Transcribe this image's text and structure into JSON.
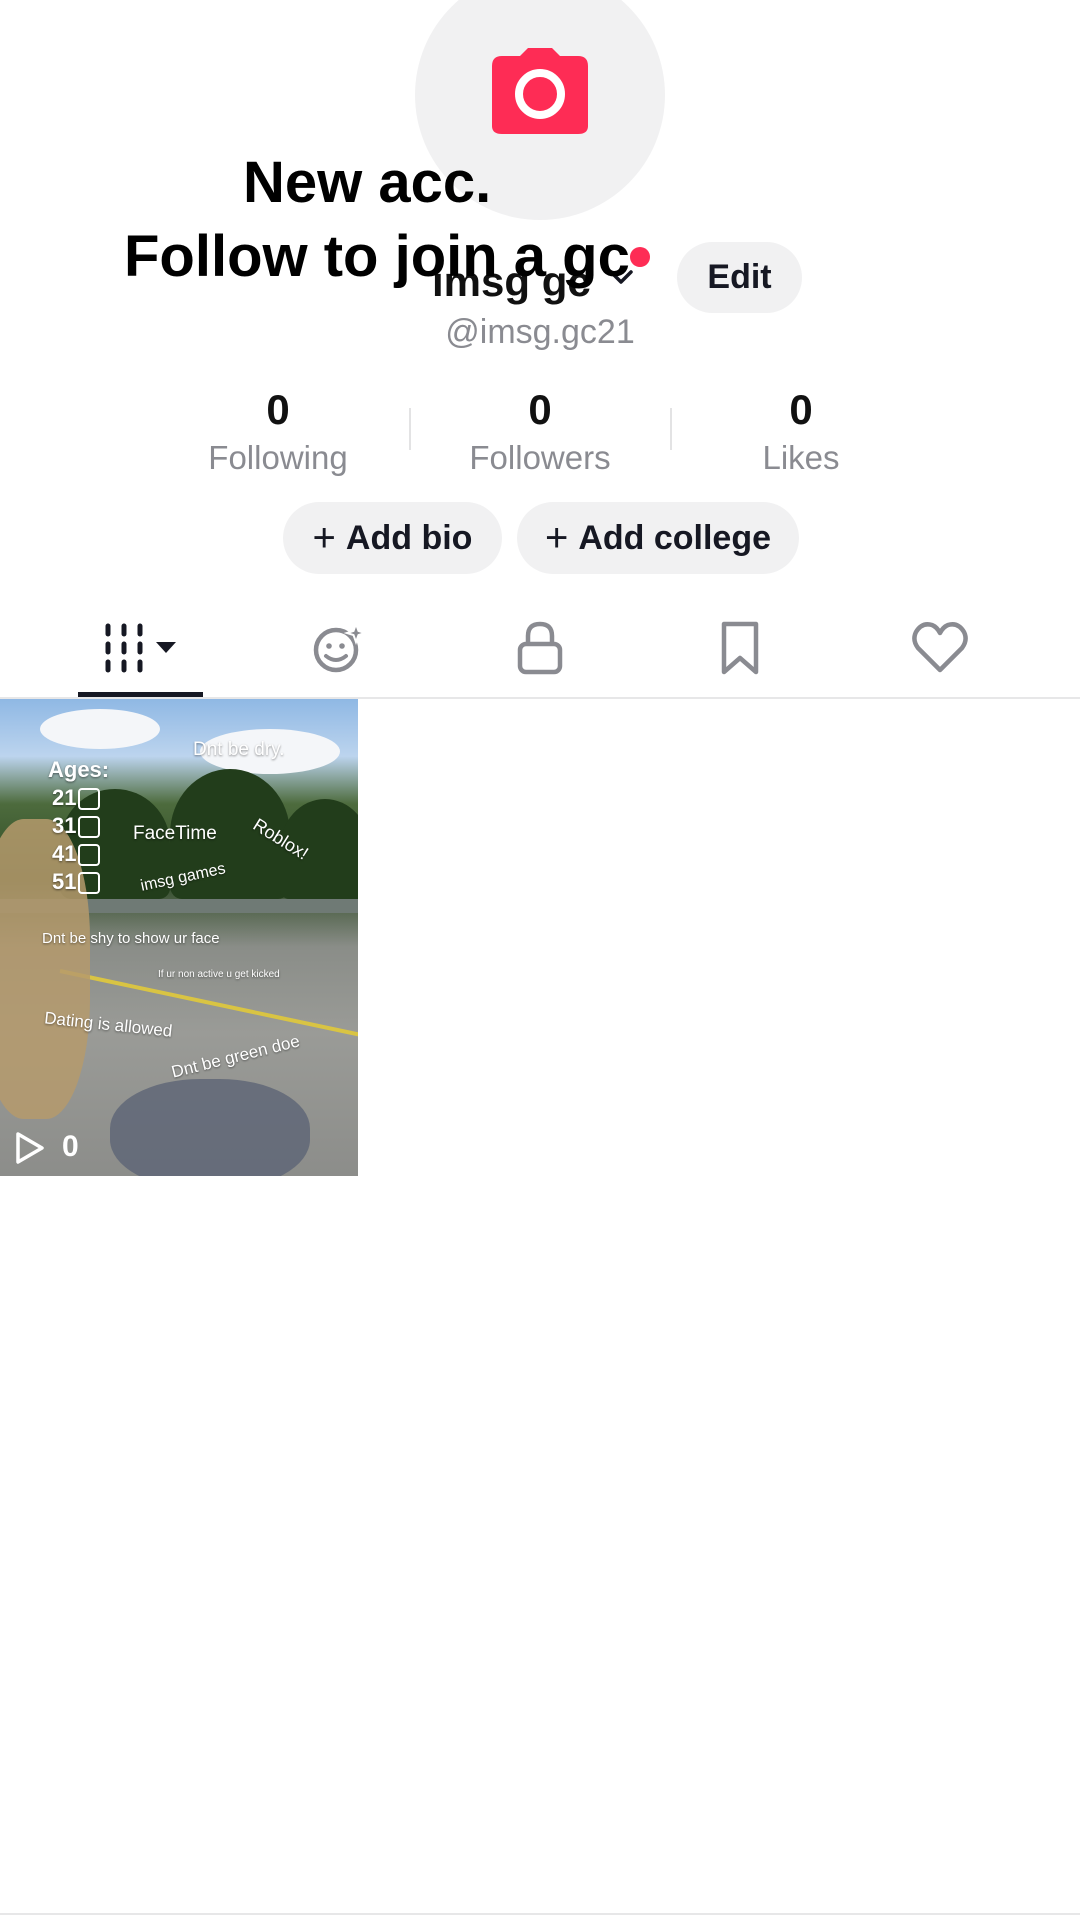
{
  "overlay_caption": {
    "line1": "New acc.",
    "line2": "Follow to join a gc"
  },
  "profile": {
    "username": "imsg gc",
    "handle": "@imsg.gc21",
    "edit_label": "Edit"
  },
  "stats": [
    {
      "value": "0",
      "label": "Following"
    },
    {
      "value": "0",
      "label": "Followers"
    },
    {
      "value": "0",
      "label": "Likes"
    }
  ],
  "actions": {
    "add_bio": "Add bio",
    "add_college": "Add college"
  },
  "tabs": [
    {
      "icon": "videos-grid-icon",
      "selected": true
    },
    {
      "icon": "repost-icon",
      "selected": false
    },
    {
      "icon": "lock-icon",
      "selected": false
    },
    {
      "icon": "bookmark-icon",
      "selected": false
    },
    {
      "icon": "heart-icon",
      "selected": false
    }
  ],
  "videos": [
    {
      "view_count": "0",
      "overlay_texts": {
        "ages_header": "Ages:",
        "ages": [
          "21",
          "31",
          "41",
          "51"
        ],
        "dnt_be_dry": "Dnt be dry.",
        "facetime": "FaceTime",
        "roblox": "Roblox!",
        "imsg_games": "imsg games",
        "show_face": "Dnt be shy to show ur face",
        "kicked": "If ur non active u get kicked",
        "dating": "Dating is allowed",
        "green": "Dnt be green doe"
      }
    }
  ],
  "colors": {
    "accent": "#fe2c55",
    "pill_bg": "#f1f1f2",
    "secondary_text": "#8a8b91"
  }
}
